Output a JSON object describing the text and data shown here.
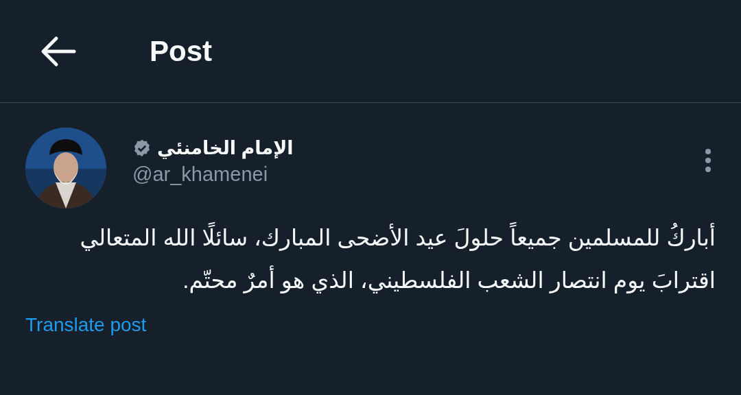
{
  "header": {
    "title": "Post"
  },
  "post": {
    "author": {
      "name": "الإمام الخامنئي",
      "verified": true,
      "handle": "@ar_khamenei"
    },
    "text": "أباركُ للمسلمين جميعاً حلولَ عيد الأضحى المبارك، سائلًا الله المتعالي اقترابَ يوم انتصار الشعب الفلسطيني، الذي هو أمرٌ محتّم.",
    "translate_link": "Translate post"
  }
}
